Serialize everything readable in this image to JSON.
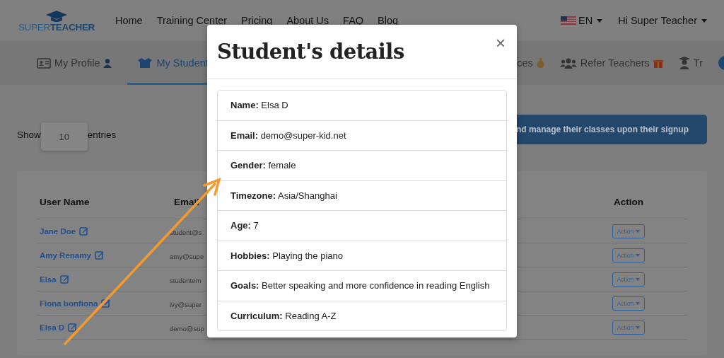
{
  "header": {
    "logo": [
      "SUPER",
      "TEACHER"
    ],
    "nav": [
      "Home",
      "Training Center",
      "Pricing",
      "About Us",
      "FAQ",
      "Blog"
    ],
    "language": "EN",
    "user_menu": "Hi Super Teacher"
  },
  "tabs": [
    {
      "label": "My Profile",
      "selected": false
    },
    {
      "label": "My Student",
      "selected": true
    },
    {
      "label": "ces",
      "selected": false
    },
    {
      "label": "Refer Teachers",
      "selected": false
    },
    {
      "label": "Tr",
      "selected": false
    }
  ],
  "length_menu": {
    "prefix": "Show",
    "value": "10",
    "suffix": "entries"
  },
  "banner": "nd manage their classes upon their signup",
  "table": {
    "columns": [
      "User Name",
      "Email",
      "Action"
    ],
    "rows": [
      {
        "name": "Jane Doe",
        "email": "student@s",
        "action": "Action"
      },
      {
        "name": "Amy Renamy",
        "email": "amy@supe",
        "action": "Action"
      },
      {
        "name": "Elsa",
        "email": "studentem",
        "action": "Action"
      },
      {
        "name": "Fiona bonfiona",
        "email": "ivy@super",
        "action": "Action"
      },
      {
        "name": "Elsa D",
        "email": "demo@sup",
        "action": "Action"
      }
    ]
  },
  "modal": {
    "title": "Student's details",
    "close": "×",
    "details": [
      "**Name:** Elsa D",
      "**Email:** demo@super-kid.net",
      "**Gender:** female",
      "**Timezone:** Asia/Shanghai",
      "**Age:** 7",
      "**Hobbies:** Playing the piano",
      "**Goals:** Better speaking and more confidence in reading English",
      "**Curriculum:** Reading A-Z"
    ]
  }
}
